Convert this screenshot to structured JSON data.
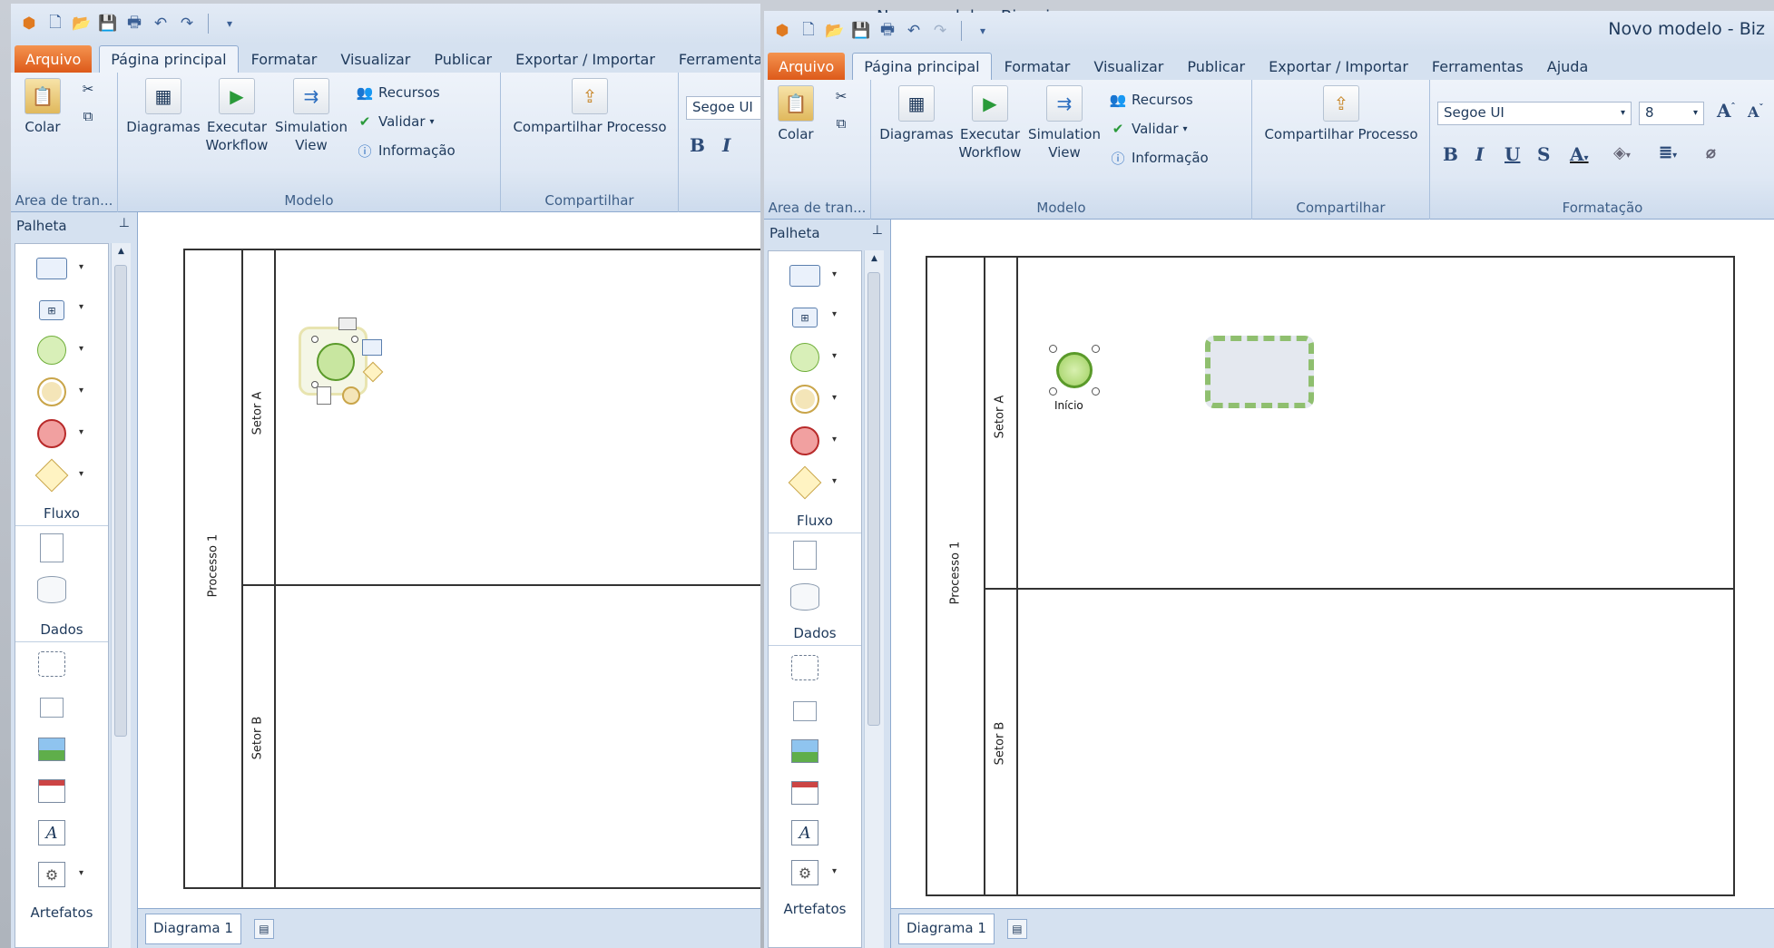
{
  "window_left": {
    "qat_title_fragment": "Novo modelo - Bizagi",
    "tabs": [
      "Arquivo",
      "Página principal",
      "Formatar",
      "Visualizar",
      "Publicar",
      "Exportar / Importar",
      "Ferramentas"
    ],
    "clipboard": {
      "paste_label": "Colar",
      "group_label": "Area de tran..."
    },
    "modelo": {
      "diagramas": "Diagramas",
      "executar": "Executar Workflow",
      "simulation": "Simulation View",
      "recursos": "Recursos",
      "validar": "Validar",
      "informacao": "Informação",
      "group_label": "Modelo"
    },
    "compartilhar": {
      "button": "Compartilhar Processo",
      "group_label": "Compartilhar"
    },
    "font_name": "Segoe UI",
    "palette": {
      "title": "Palheta",
      "fluxo": "Fluxo",
      "dados": "Dados",
      "artefatos": "Artefatos"
    },
    "diagram": {
      "pool": "Processo 1",
      "lane_a": "Setor A",
      "lane_b": "Setor B"
    },
    "status_tab": "Diagrama 1"
  },
  "window_right": {
    "title": "Novo modelo - Biz",
    "tabs": [
      "Arquivo",
      "Página principal",
      "Formatar",
      "Visualizar",
      "Publicar",
      "Exportar / Importar",
      "Ferramentas",
      "Ajuda"
    ],
    "clipboard": {
      "paste_label": "Colar",
      "group_label": "Area de tran..."
    },
    "modelo": {
      "diagramas": "Diagramas",
      "executar": "Executar Workflow",
      "simulation": "Simulation View",
      "recursos": "Recursos",
      "validar": "Validar",
      "informacao": "Informação",
      "group_label": "Modelo"
    },
    "compartilhar": {
      "button": "Compartilhar Processo",
      "group_label": "Compartilhar"
    },
    "formatacao": {
      "font_name": "Segoe UI",
      "font_size": "8",
      "group_label": "Formatação"
    },
    "palette": {
      "title": "Palheta",
      "fluxo": "Fluxo",
      "dados": "Dados",
      "artefatos": "Artefatos"
    },
    "diagram": {
      "pool": "Processo 1",
      "lane_a": "Setor A",
      "lane_b": "Setor B",
      "start_label": "Início"
    },
    "status_tab": "Diagrama 1"
  },
  "colors": {
    "file_tab": "#e5651f",
    "ribbon": "#dfe8f4",
    "start_event": "#c8e6a0",
    "end_event": "#e66060",
    "gateway": "#fff3c2"
  }
}
